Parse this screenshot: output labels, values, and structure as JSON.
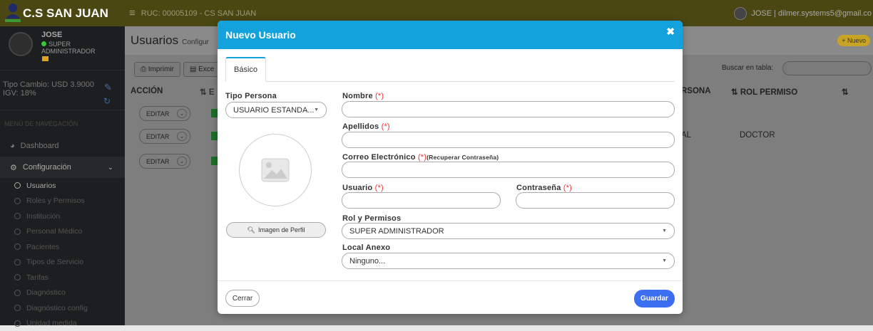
{
  "topbar": {
    "brand": "C.S SAN JUAN",
    "ruc": "RUC: 00005109 - CS SAN JUAN",
    "user": "JOSE | dilmer.systems5@gmail.co"
  },
  "sidebar": {
    "user_name": "JOSE",
    "user_role": "SUPER ADMINISTRADOR",
    "tipo_cambio": "Tipo Cambio: USD 3.9000",
    "igv": "IGV: 18%",
    "nav_header": "MENÚ DE NAVEGACIÓN",
    "dashboard": "Dashboard",
    "configuracion": "Configuración",
    "subitems": [
      "Usuarios",
      "Roles y Permisos",
      "Institución",
      "Personal Médico",
      "Pacientes",
      "Tipos de Servicio",
      "Tarifas",
      "Diagnóstico",
      "Diagnóstico config",
      "Unidad medida"
    ]
  },
  "page": {
    "title": "Usuarios",
    "subtitle": "Configur",
    "new_button": "+ Nuevo",
    "print": "Imprimir",
    "excel": "Exce",
    "search_label": "Buscar en tabla:",
    "columns": [
      "ACCIÓN",
      "E",
      "RSONA",
      "ROL PERMISO"
    ],
    "row_action": "EDITAR",
    "rows": [
      {
        "persona": "",
        "rol": ""
      },
      {
        "persona": "AL",
        "rol": "DOCTOR"
      },
      {
        "persona": "",
        "rol": ""
      }
    ]
  },
  "modal": {
    "title": "Nuevo Usuario",
    "tab": "Básico",
    "tipo_persona_label": "Tipo Persona",
    "tipo_persona_value": "USUARIO ESTANDA...",
    "image_button": "Imagen de Perfil",
    "nombre_label": "Nombre",
    "apellidos_label": "Apellidos",
    "correo_label": "Correo Electrónico",
    "recuperar": "(Recuperar Contraseña)",
    "usuario_label": "Usuario",
    "contrasena_label": "Contraseña",
    "required_mark": "(*)",
    "rol_label": "Rol y Permisos",
    "rol_value": "SUPER ADMINISTRADOR",
    "local_label": "Local Anexo",
    "local_value": "Ninguno...",
    "cerrar": "Cerrar",
    "guardar": "Guardar"
  }
}
